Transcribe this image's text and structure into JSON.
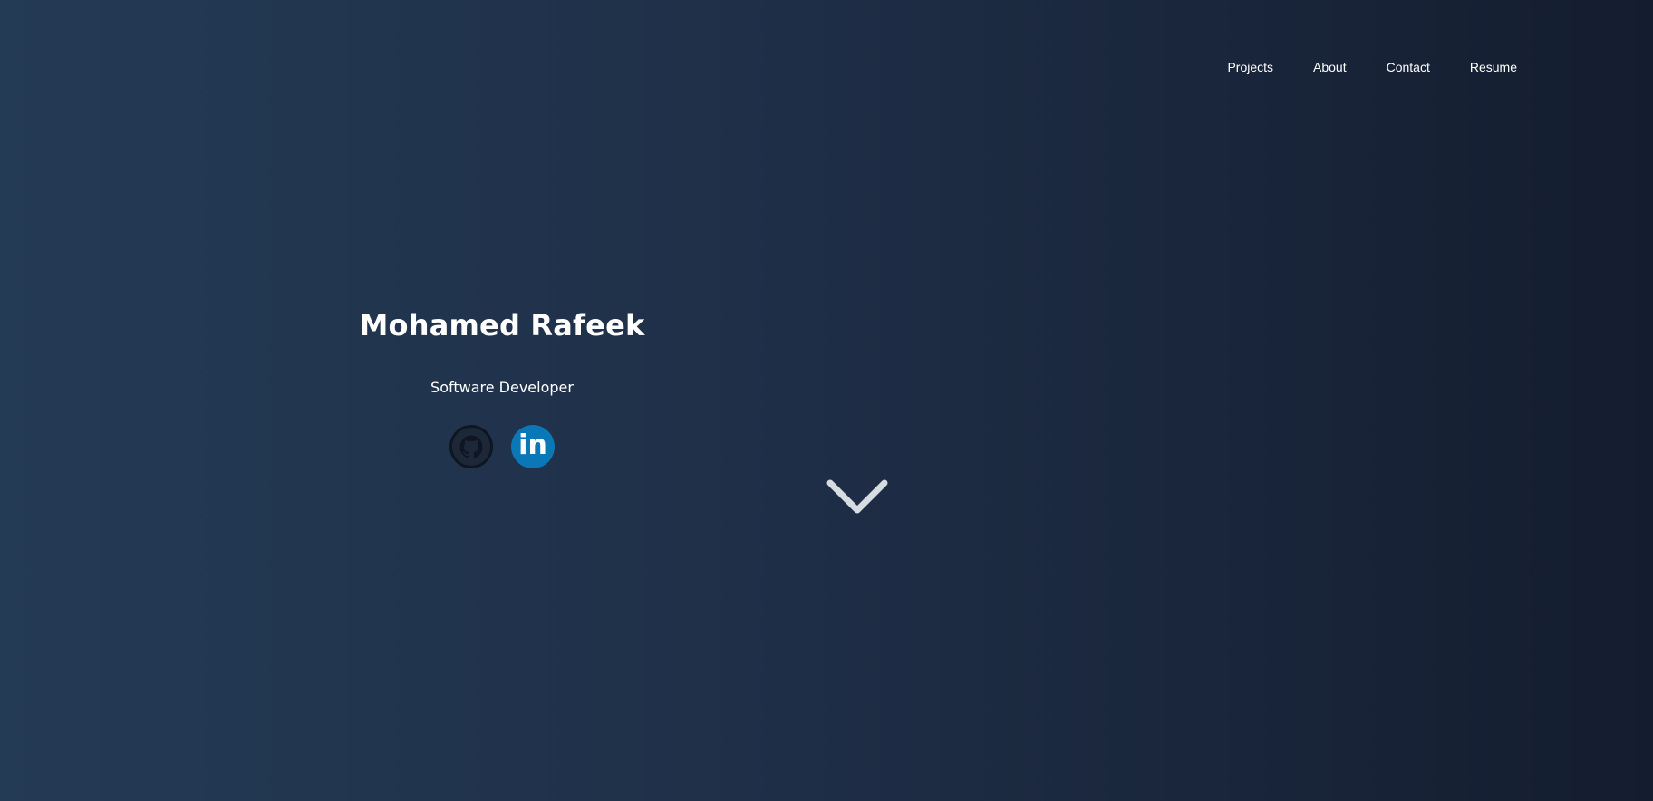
{
  "nav": {
    "items": [
      {
        "label": "Projects"
      },
      {
        "label": "About"
      },
      {
        "label": "Contact"
      },
      {
        "label": "Resume"
      }
    ]
  },
  "hero": {
    "name": "Mohamed Rafeek",
    "title": "Software Developer"
  },
  "socials": [
    {
      "icon": "github-icon",
      "color": "#0f1622"
    },
    {
      "icon": "linkedin-icon",
      "color": "#0a78b7",
      "glyph": "in"
    }
  ],
  "scroll": {
    "icon": "chevron-down-icon",
    "color": "#d7dbe2"
  },
  "colors": {
    "background_start": "#243b55",
    "background_end": "#141d2f",
    "text": "#ffffff"
  }
}
